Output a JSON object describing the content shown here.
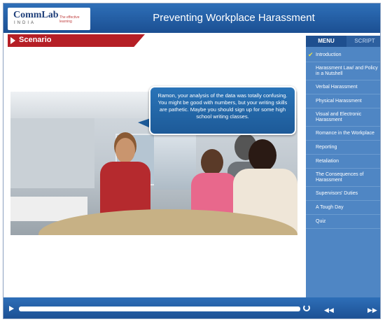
{
  "header": {
    "logo_brand": "CommLab",
    "logo_sub": "INDIA",
    "logo_tag": "The\neffective learning",
    "title": "Preventing Workplace Harassment"
  },
  "scenario": {
    "label": "Scenario"
  },
  "bubble": {
    "text": "Ramon, your analysis of the data was totally confusing. You might be good with numbers, but your writing skills are pathetic. Maybe you should sign up for some high school writing classes."
  },
  "sidebar": {
    "tabs": {
      "menu": "MENU",
      "script": "SCRIPT"
    },
    "items": [
      {
        "label": "Introduction",
        "checked": true
      },
      {
        "label": "Harassment Law/ and Policy in a Nutshell"
      },
      {
        "label": "Verbal Harassment"
      },
      {
        "label": "Physical Harassment"
      },
      {
        "label": "Visual and Electronic Harassment"
      },
      {
        "label": "Romance in the Workplace"
      },
      {
        "label": "Reporting"
      },
      {
        "label": "Retaliation"
      },
      {
        "label": "The Consequences of Harassment"
      },
      {
        "label": "Supervisors' Duties"
      },
      {
        "label": "A Tough Day"
      },
      {
        "label": "Quiz"
      }
    ]
  },
  "colors": {
    "accent": "#1b4f92",
    "sidebar": "#4f86c4",
    "scenario_tab": "#b51f26",
    "check": "#f0e040"
  },
  "icons": {
    "play": "play-icon",
    "replay": "replay-icon",
    "rewind": "rewind-icon",
    "fast_forward": "fast-forward-icon"
  }
}
